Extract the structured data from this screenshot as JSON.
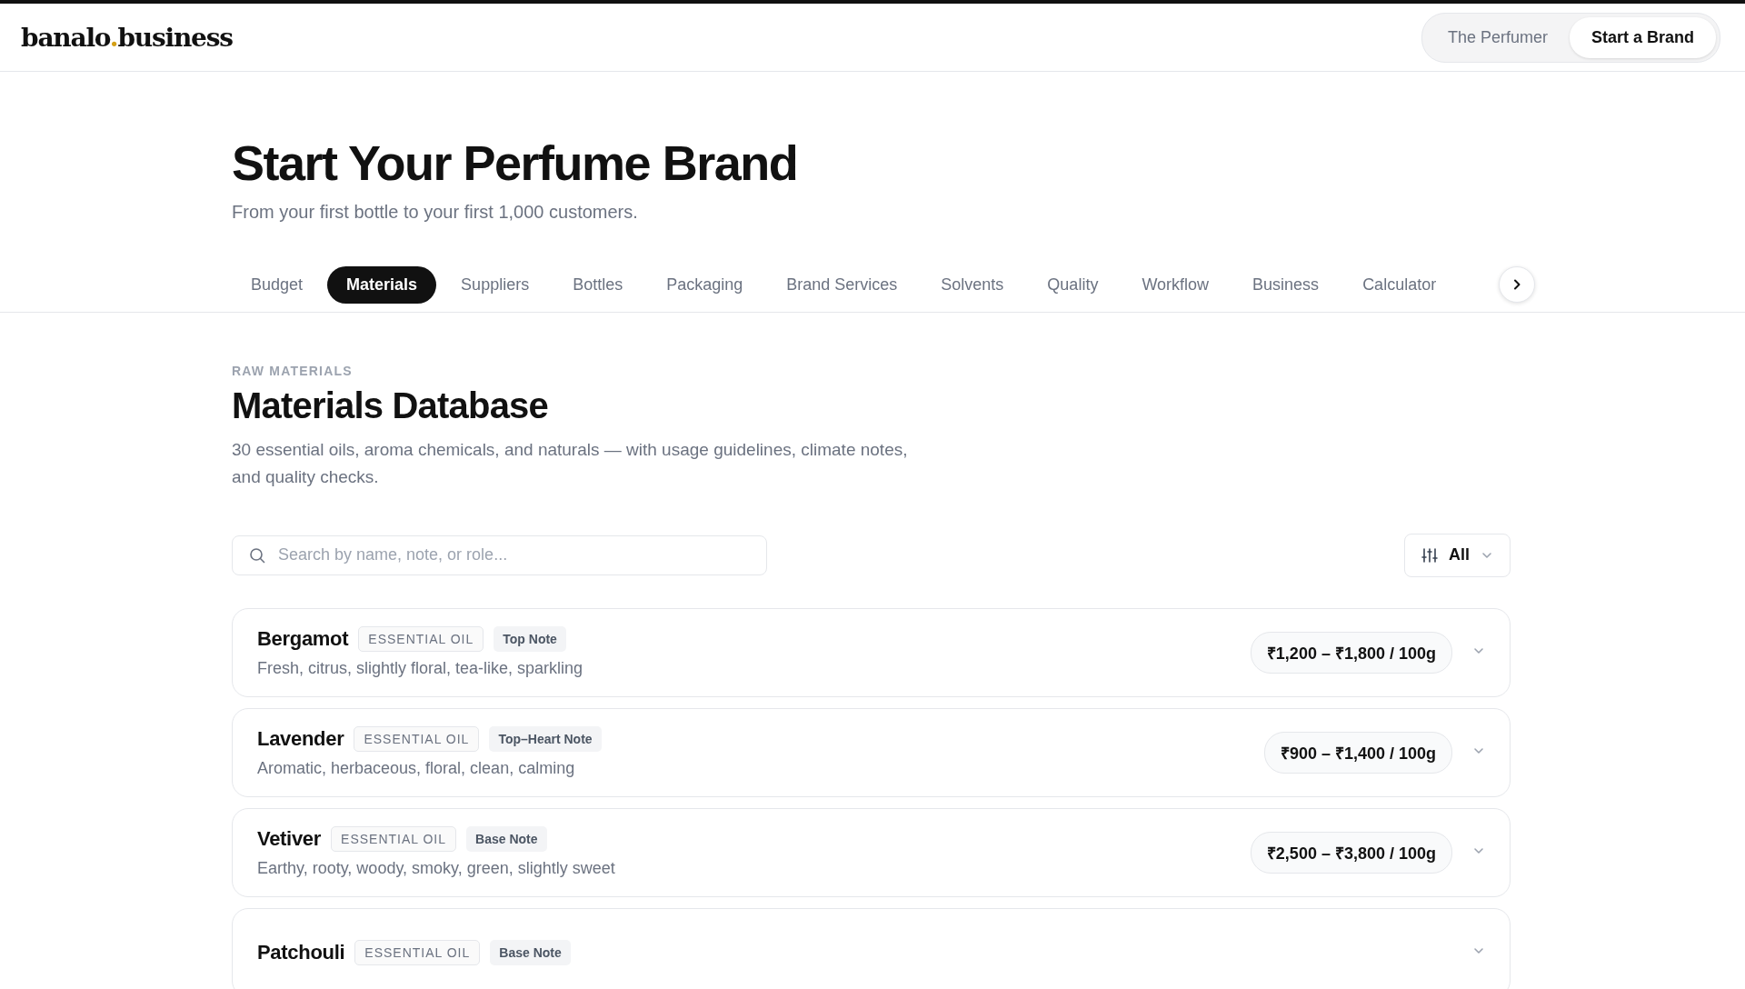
{
  "header": {
    "logo": {
      "left": "banalo",
      "dot": ".",
      "right": "business"
    },
    "nav": [
      {
        "label": "The Perfumer",
        "selected": false
      },
      {
        "label": "Start a Brand",
        "selected": true
      }
    ]
  },
  "hero": {
    "title": "Start Your Perfume Brand",
    "subtitle": "From your first bottle to your first 1,000 customers."
  },
  "tabs": [
    {
      "label": "Budget",
      "selected": false
    },
    {
      "label": "Materials",
      "selected": true
    },
    {
      "label": "Suppliers",
      "selected": false
    },
    {
      "label": "Bottles",
      "selected": false
    },
    {
      "label": "Packaging",
      "selected": false
    },
    {
      "label": "Brand Services",
      "selected": false
    },
    {
      "label": "Solvents",
      "selected": false
    },
    {
      "label": "Quality",
      "selected": false
    },
    {
      "label": "Workflow",
      "selected": false
    },
    {
      "label": "Business",
      "selected": false
    },
    {
      "label": "Calculator",
      "selected": false
    }
  ],
  "section": {
    "eyebrow": "RAW MATERIALS",
    "title": "Materials Database",
    "description": "30 essential oils, aroma chemicals, and naturals — with usage guidelines, climate notes, and quality checks.",
    "search": {
      "placeholder": "Search by name, note, or role..."
    },
    "filter": {
      "label": "All"
    }
  },
  "materials": [
    {
      "name": "Bergamot",
      "type": "ESSENTIAL OIL",
      "note": "Top Note",
      "description": "Fresh, citrus, slightly floral, tea-like, sparkling",
      "price": "₹1,200 – ₹1,800 / 100g",
      "expanded": false
    },
    {
      "name": "Lavender",
      "type": "ESSENTIAL OIL",
      "note": "Top–Heart Note",
      "description": "Aromatic, herbaceous, floral, clean, calming",
      "price": "₹900 – ₹1,400 / 100g",
      "expanded": false
    },
    {
      "name": "Vetiver",
      "type": "ESSENTIAL OIL",
      "note": "Base Note",
      "description": "Earthy, rooty, woody, smoky, green, slightly sweet",
      "price": "₹2,500 – ₹3,800 / 100g",
      "expanded": false
    },
    {
      "name": "Patchouli",
      "type": "ESSENTIAL OIL",
      "note": "Base Note",
      "expanded": false
    }
  ]
}
